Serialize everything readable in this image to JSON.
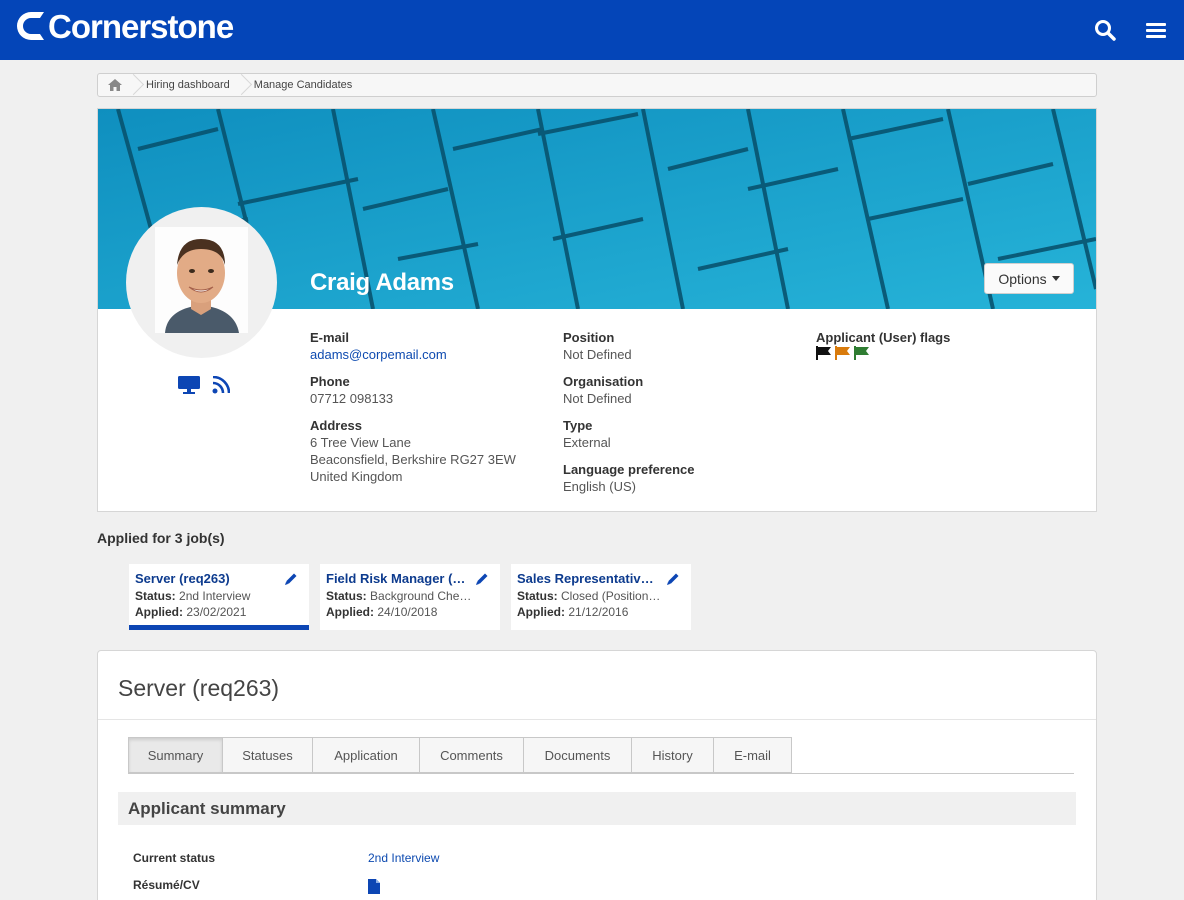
{
  "brand": {
    "name": "Cornerstone"
  },
  "breadcrumb": {
    "items": [
      "Hiring dashboard",
      "Manage Candidates"
    ]
  },
  "profile": {
    "name": "Craig Adams",
    "options_label": "Options",
    "email_label": "E-mail",
    "email": "adams@corpemail.com",
    "phone_label": "Phone",
    "phone": "07712 098133",
    "address_label": "Address",
    "address_lines": [
      "6 Tree View Lane",
      "Beaconsfield, Berkshire RG27 3EW",
      "United Kingdom"
    ],
    "position_label": "Position",
    "position": "Not Defined",
    "organisation_label": "Organisation",
    "organisation": "Not Defined",
    "type_label": "Type",
    "type": "External",
    "language_label": "Language preference",
    "language": "English (US)",
    "flags_label": "Applicant (User) flags",
    "flag_colors": [
      "#111111",
      "#d97b0c",
      "#2f7d32"
    ]
  },
  "applied": {
    "title": "Applied for 3 job(s)",
    "jobs": [
      {
        "title": "Server (req263)",
        "status_label": "Status:",
        "status": "2nd Interview",
        "applied_label": "Applied:",
        "applied": "23/02/2021"
      },
      {
        "title": "Field Risk Manager (…",
        "status_label": "Status:",
        "status": "Background Che…",
        "applied_label": "Applied:",
        "applied": "24/10/2018"
      },
      {
        "title": "Sales Representative…",
        "status_label": "Status:",
        "status": "Closed (Position…",
        "applied_label": "Applied:",
        "applied": "21/12/2016"
      }
    ]
  },
  "detail": {
    "title": "Server (req263)",
    "tabs": [
      "Summary",
      "Statuses",
      "Application",
      "Comments",
      "Documents",
      "History",
      "E-mail"
    ],
    "section_title": "Applicant summary",
    "current_status_label": "Current status",
    "current_status": "2nd Interview",
    "resume_label": "Résumé/CV"
  },
  "colors": {
    "topbar": "#0445b8",
    "accent": "#0d46b4",
    "link": "#0d4ab0"
  }
}
